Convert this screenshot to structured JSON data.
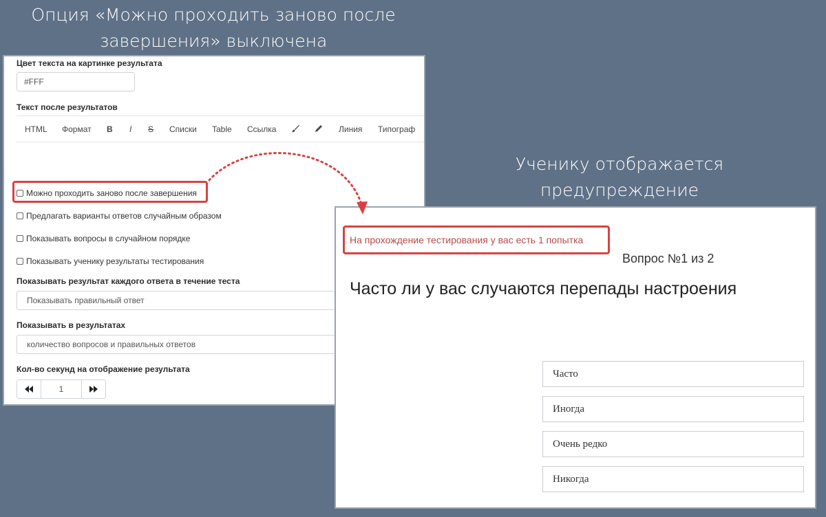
{
  "captions": {
    "left_line1": "Опция «Можно проходить заново после",
    "left_line2": "завершения» выключена",
    "right_line1": "Ученику отображается",
    "right_line2": "предупреждение"
  },
  "settings": {
    "text_color_label": "Цвет текста на картинке результата",
    "text_color_value": "#FFF",
    "after_results_label": "Текст после результатов",
    "toolbar": [
      "HTML",
      "Формат",
      "B",
      "I",
      "S",
      "Списки",
      "Table",
      "Ссылка",
      "Линия",
      "Типограф"
    ],
    "checkboxes": [
      "Можно проходить заново после завершения",
      "Предлагать варианты ответов случайным образом",
      "Показывать вопросы в случайном порядке",
      "Показывать ученику результаты тестирования"
    ],
    "show_each_answer_label": "Показывать результат каждого ответа в течение теста",
    "show_each_answer_value": "Показывать правильный ответ",
    "show_in_results_label": "Показывать в результатах",
    "show_in_results_value": "количество вопросов и правильных ответов",
    "seconds_label": "Кол-во секунд на отображение результата",
    "seconds_value": "1"
  },
  "preview": {
    "warning": "На прохождение тестирования у вас есть 1 попытка",
    "question_number": "Вопрос №1 из 2",
    "question": "Часто ли у вас случаются перепады настроения",
    "answers": [
      "Часто",
      "Иногда",
      "Очень редко",
      "Никогда"
    ]
  },
  "colors": {
    "background": "#5f7186",
    "highlight": "#d94141",
    "warning_text": "#b94a48"
  }
}
